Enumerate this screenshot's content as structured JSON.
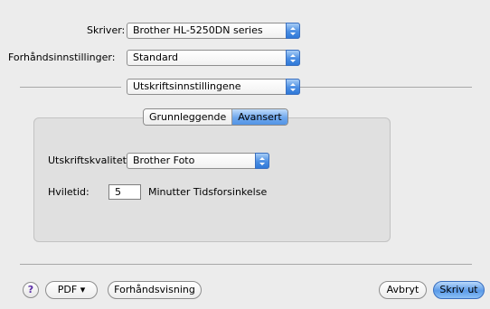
{
  "printer": {
    "label": "Skriver:",
    "value": "Brother HL-5250DN series"
  },
  "presets": {
    "label": "Forhåndsinnstillinger:",
    "value": "Standard"
  },
  "panel_selector": {
    "value": "Utskriftsinnstillingene"
  },
  "tabs": [
    {
      "label": "Grunnleggende",
      "selected": false
    },
    {
      "label": "Avansert",
      "selected": true
    }
  ],
  "quality": {
    "label": "Utskriftskvalitet:",
    "value": "Brother Foto"
  },
  "sleep": {
    "label": "Hviletid:",
    "value": "5",
    "unit_label": "Minutter Tidsforsinkelse"
  },
  "footer": {
    "help": "?",
    "pdf": "PDF ▾",
    "preview": "Forhåndsvisning",
    "cancel": "Avbryt",
    "print": "Skriv ut"
  },
  "icons": {
    "popup_arrows": "updown-arrows-icon"
  }
}
